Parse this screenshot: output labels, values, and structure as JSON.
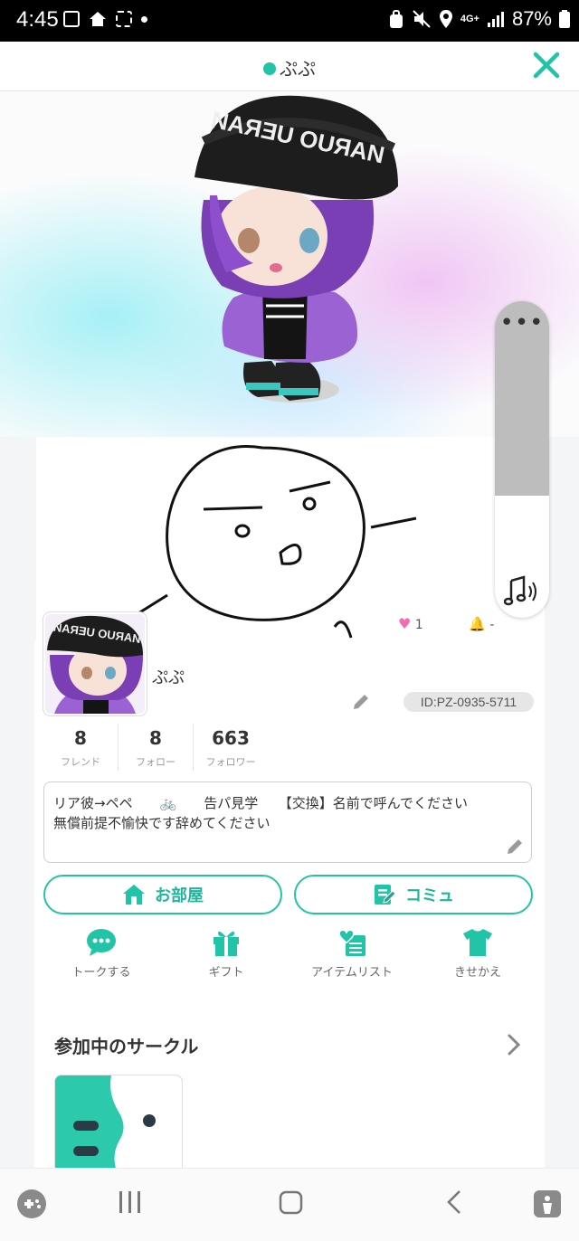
{
  "status_bar": {
    "time": "4:45",
    "network": "4G+",
    "battery": "87%"
  },
  "header": {
    "title": "ぷぷ"
  },
  "drawing_side": {
    "likes": "1",
    "bells": "-"
  },
  "profile": {
    "name": "ぷぷ",
    "id": "ID:PZ-0935-5711",
    "stats": [
      {
        "value": "8",
        "label": "フレンド"
      },
      {
        "value": "8",
        "label": "フォロー"
      },
      {
        "value": "663",
        "label": "フォロワー"
      }
    ],
    "bio_line1": "リア彼→ペペ　　🚲　　告パ見学　　【交換】名前で呼んでください",
    "bio_line2": "無償前提不愉快です辞めてください"
  },
  "buttons": {
    "room": "お部屋",
    "community": "コミュ"
  },
  "actions": [
    {
      "label": "トークする",
      "icon": "chat-icon"
    },
    {
      "label": "ギフト",
      "icon": "gift-icon"
    },
    {
      "label": "アイテムリスト",
      "icon": "item-list-icon"
    },
    {
      "label": "きせかえ",
      "icon": "tshirt-icon"
    }
  ],
  "circles": {
    "title": "参加中のサークル"
  },
  "colors": {
    "accent": "#22c4a8",
    "background": "#f4f5f6"
  }
}
